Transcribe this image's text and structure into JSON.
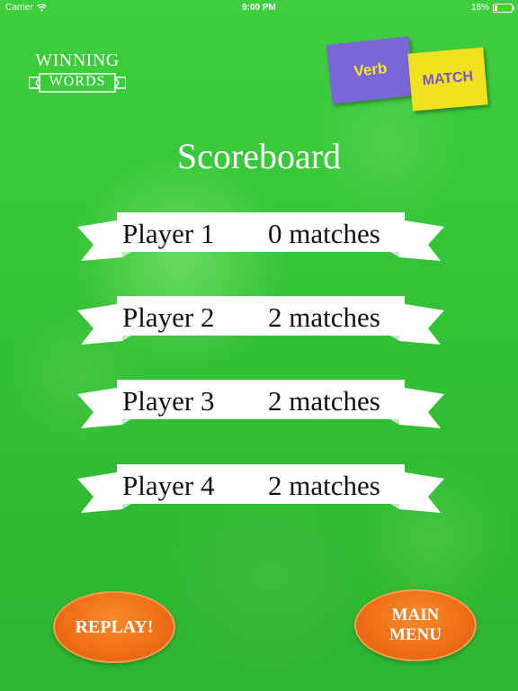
{
  "status_bar": {
    "carrier": "Carrier",
    "time": "9:00 PM",
    "battery": "18%",
    "battery_level": 0.18
  },
  "logo": {
    "top": "WINNING",
    "bottom": "WORDS"
  },
  "cards": {
    "verb": "Verb",
    "match": "MATCH"
  },
  "title": "Scoreboard",
  "players": [
    {
      "name": "Player 1",
      "score": "0 matches"
    },
    {
      "name": "Player 2",
      "score": "2 matches"
    },
    {
      "name": "Player 3",
      "score": "2 matches"
    },
    {
      "name": "Player 4",
      "score": "2 matches"
    }
  ],
  "buttons": {
    "replay": "REPLAY!",
    "main_menu_line1": "MAIN",
    "main_menu_line2": "MENU"
  },
  "colors": {
    "background": "#33c236",
    "button_orange": "#ef6d17",
    "verb_card": "#7b66d6",
    "match_card": "#f0e21f"
  }
}
